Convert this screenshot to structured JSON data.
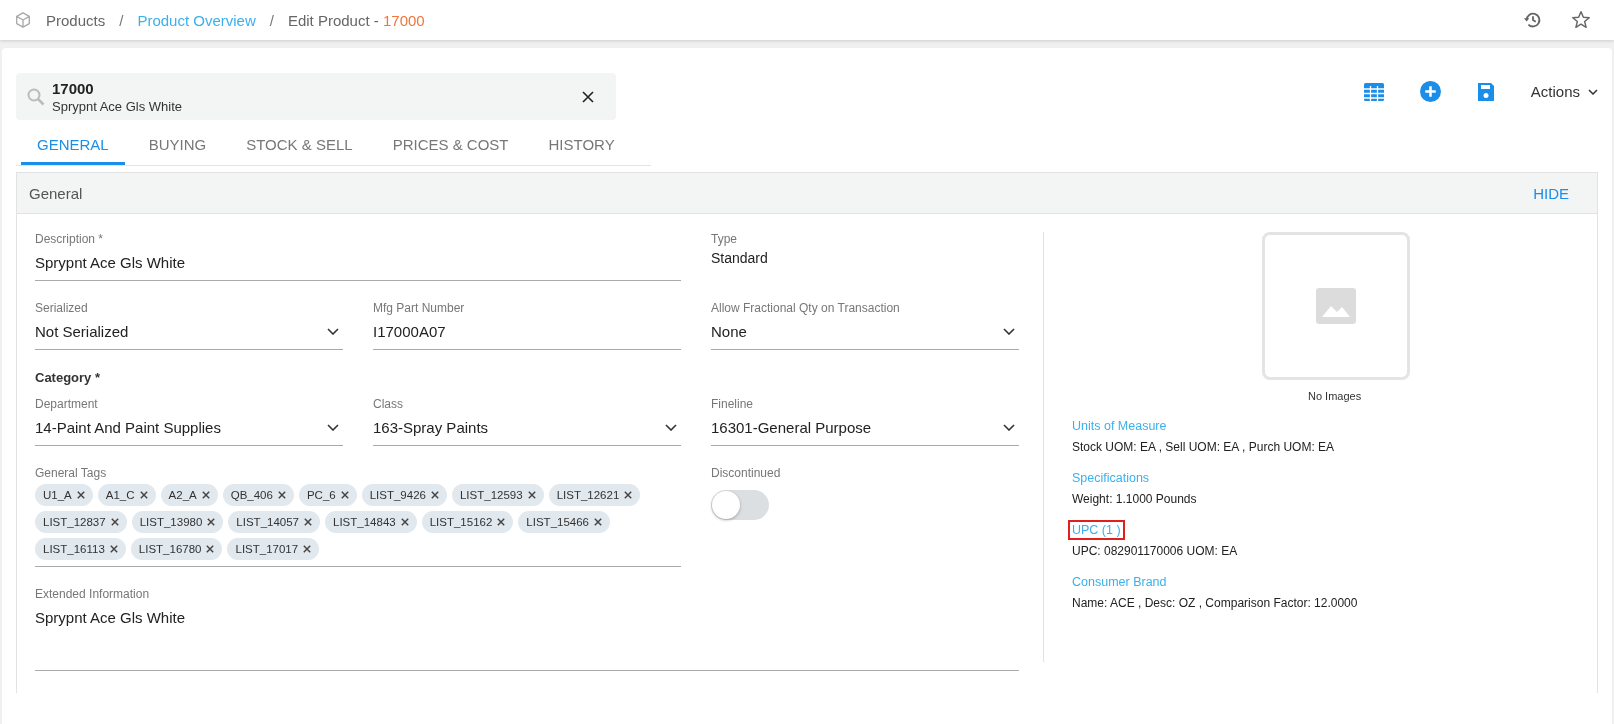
{
  "breadcrumb": [
    {
      "kind": "item",
      "label": "Products"
    },
    {
      "kind": "separator",
      "label": "/"
    },
    {
      "kind": "link",
      "label": "Product Overview"
    },
    {
      "kind": "separator",
      "label": "/"
    },
    {
      "kind": "current",
      "label": "Edit Product - ",
      "number": "17000"
    }
  ],
  "search": {
    "value": "17000",
    "subtitle": "Sprypnt Ace Gls White"
  },
  "toolbar": {
    "actions_label": "Actions"
  },
  "tabs": [
    {
      "label": "GENERAL",
      "selected": true
    },
    {
      "label": "BUYING",
      "selected": false
    },
    {
      "label": "STOCK & SELL",
      "selected": false
    },
    {
      "label": "PRICES & COST",
      "selected": false
    },
    {
      "label": "HISTORY",
      "selected": false
    }
  ],
  "section": {
    "title": "General",
    "toggle": "HIDE"
  },
  "form": {
    "rows": [
      [
        {
          "kind": "wide_text",
          "label": "Description *",
          "value": "Sprypnt Ace Gls White"
        },
        {
          "kind": "static",
          "label": "Type",
          "value": "Standard"
        }
      ],
      [
        {
          "kind": "select",
          "label": "Serialized",
          "value": "Not Serialized"
        },
        {
          "kind": "text",
          "label": "Mfg Part Number",
          "value": "I17000A07"
        },
        {
          "kind": "select",
          "label": "Allow Fractional Qty on Transaction",
          "value": "None"
        }
      ],
      [
        {
          "kind": "heading",
          "label": "Category *"
        }
      ],
      [
        {
          "kind": "select",
          "label": "Department",
          "value": "14-Paint And Paint Supplies"
        },
        {
          "kind": "select",
          "label": "Class",
          "value": "163-Spray Paints"
        },
        {
          "kind": "select",
          "label": "Fineline",
          "value": "16301-General Purpose"
        }
      ],
      [
        {
          "kind": "tags",
          "label": "General Tags",
          "tags": [
            "U1_A",
            "A1_C",
            "A2_A",
            "QB_406",
            "PC_6",
            "LIST_9426",
            "LIST_12593",
            "LIST_12621",
            "LIST_12837",
            "LIST_13980",
            "LIST_14057",
            "LIST_14843",
            "LIST_15162",
            "LIST_15466",
            "LIST_16113",
            "LIST_16780",
            "LIST_17017"
          ]
        },
        {
          "kind": "toggle",
          "label": "Discontinued",
          "on": false
        }
      ],
      [
        {
          "kind": "area",
          "label": "Extended Information",
          "value": "Sprypnt Ace Gls White"
        }
      ]
    ]
  },
  "image_panel": {
    "caption": "No Images"
  },
  "info_groups": [
    {
      "title": "Units of Measure",
      "text": "Stock UOM: EA , Sell UOM: EA  , Purch UOM: EA",
      "highlighted": false
    },
    {
      "title": "Specifications",
      "text": "Weight: 1.1000 Pounds",
      "highlighted": false
    },
    {
      "title": "UPC (1 )",
      "text": "UPC: 082901170006  UOM: EA",
      "highlighted": true
    },
    {
      "title": "Consumer Brand",
      "text": "Name: ACE , Desc: OZ , Comparison Factor: 12.0000",
      "highlighted": false
    }
  ]
}
